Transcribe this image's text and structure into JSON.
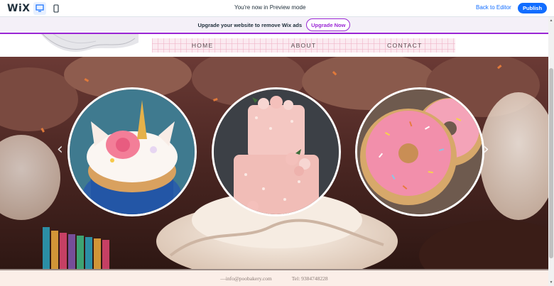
{
  "editor": {
    "logo": "WiX",
    "preview_notice": "You're now in Preview mode",
    "back_link": "Back to Editor",
    "publish_label": "Publish"
  },
  "banner": {
    "text": "Upgrade your website to remove Wix ads",
    "button_label": "Upgrade Now"
  },
  "nav": {
    "items": [
      "HOME",
      "ABOUT",
      "CONTACT"
    ]
  },
  "colors": {
    "accent": "#9a27d5",
    "wix_blue": "#116dff"
  },
  "footer": {
    "email": "—info@poobakery.com",
    "phone": "Tel: 9384748228"
  }
}
